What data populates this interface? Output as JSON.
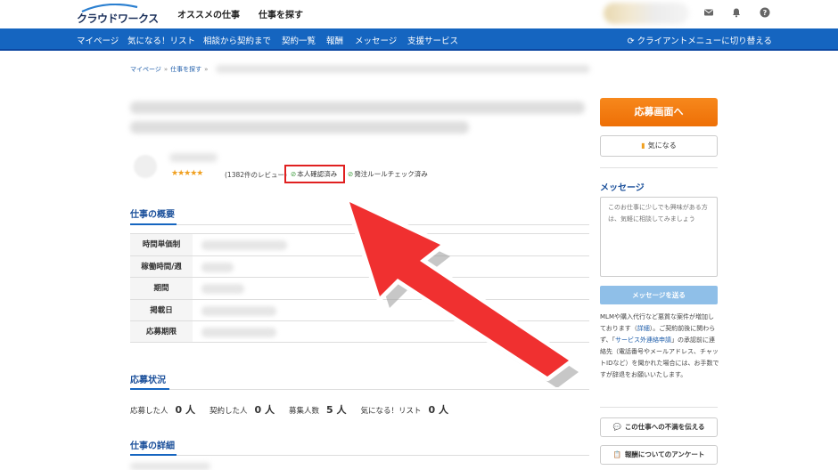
{
  "header": {
    "logo_text": "クラウドワークス",
    "nav": [
      "オススメの仕事",
      "仕事を探す"
    ],
    "icons": [
      "mail-icon",
      "bell-icon",
      "help-icon"
    ]
  },
  "bluenav": {
    "items": [
      "マイページ",
      "気になる！リスト",
      "相談から契約まで",
      "契約一覧",
      "報酬",
      "メッセージ",
      "支援サービス"
    ],
    "switch_label": "クライアントメニューに切り替える"
  },
  "breadcrumb": [
    "マイページ",
    "仕事を探す"
  ],
  "seller": {
    "stars": "★★★★★",
    "reviews": "(1382件のレビュー)",
    "badge_identity": "本人確認済み",
    "badge_rules": "発注ルールチェック済み"
  },
  "overview": {
    "title": "仕事の概要",
    "rows": [
      "時間単価制",
      "稼働時間/週",
      "期間",
      "掲載日",
      "応募期限"
    ]
  },
  "status": {
    "title": "応募状況",
    "items": [
      {
        "label": "応募した人",
        "value": "0 人"
      },
      {
        "label": "契約した人",
        "value": "0 人"
      },
      {
        "label": "募集人数",
        "value": "5 人"
      },
      {
        "label": "気になる！リスト",
        "value": "0 人"
      }
    ]
  },
  "details": {
    "title": "仕事の詳細"
  },
  "sidebar": {
    "apply_label": "応募画面へ",
    "favorite_label": "気になる",
    "message_title": "メッセージ",
    "message_placeholder": "このお仕事に少しでも興味がある方は、気軽に相談してみましょう",
    "send_label": "メッセージを送る",
    "notice_pre": "MLMや購入代行など悪質な案件が増加しております（",
    "notice_link1": "詳細",
    "notice_mid": "）。ご契約前後に関わらず、「",
    "notice_link2": "サービス外連絡申請",
    "notice_post": "」の承認前に連絡先（電話番号やメールアドレス、チャットIDなど）を聞かれた場合には、お手数ですが辞退をお願いいたします。",
    "complaint_label": "この仕事への不満を伝える",
    "survey_label": "報酬についてのアンケート"
  },
  "colors": {
    "brand_blue": "#1565c0",
    "apply_orange": "#f07a10",
    "highlight_red": "#e02020",
    "arrow_red": "#f03030"
  }
}
